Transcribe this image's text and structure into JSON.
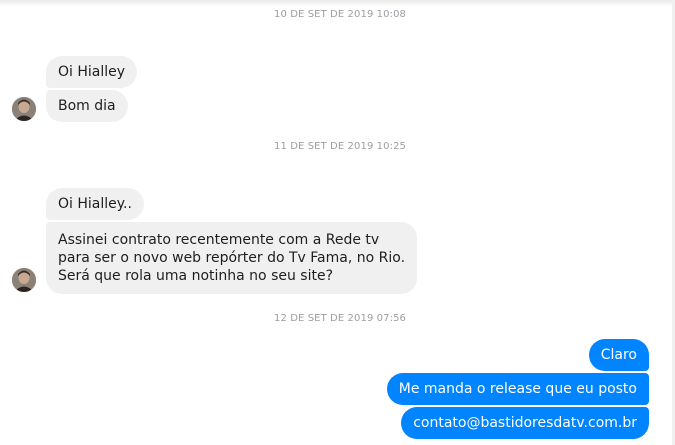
{
  "conversation": {
    "day1": {
      "timestamp": "10 DE SET DE 2019 10:08",
      "messages": [
        "Oi Hialley",
        "Bom dia"
      ]
    },
    "day2": {
      "timestamp": "11 DE SET DE 2019 10:25",
      "messages": [
        "Oi Hialley..",
        "Assinei contrato recentemente com a Rede tv\npara ser o novo web repórter do Tv Fama, no Rio.\nSerá que rola uma notinha no seu site?"
      ]
    },
    "day3": {
      "timestamp": "12 DE SET DE 2019 07:56",
      "messages": [
        "Claro",
        "Me manda o release que eu posto",
        "contato@bastidoresdatv.com.br"
      ]
    }
  },
  "colors": {
    "incoming_bubble": "#f1f0f0",
    "outgoing_bubble": "#0084ff",
    "timestamp_text": "#9b9ea3"
  },
  "icons": {
    "avatar": "contact-avatar-photo"
  }
}
